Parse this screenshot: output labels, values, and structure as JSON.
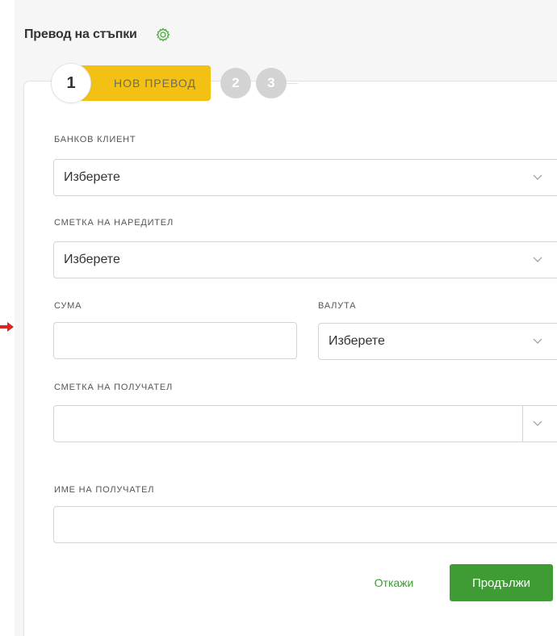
{
  "header": {
    "title": "Превод на стъпки",
    "settings_icon": "gear-icon"
  },
  "stepper": {
    "active_step_number": "1",
    "active_step_label": "НОВ ПРЕВОД",
    "step2_number": "2",
    "step3_number": "3"
  },
  "form": {
    "bank_client": {
      "label": "БАНКОВ КЛИЕНТ",
      "value": "Изберете"
    },
    "payer_account": {
      "label": "СМЕТКА НА НАРЕДИТЕЛ",
      "value": "Изберете"
    },
    "amount": {
      "label": "СУМА",
      "value": ""
    },
    "currency": {
      "label": "ВАЛУТА",
      "value": "Изберете"
    },
    "recipient_account": {
      "label": "СМЕТКА НА ПОЛУЧАТЕЛ",
      "value": ""
    },
    "recipient_name": {
      "label": "ИМЕ НА ПОЛУЧАТЕЛ",
      "value": ""
    }
  },
  "actions": {
    "cancel_label": "Откажи",
    "continue_label": "Продължи"
  },
  "colors": {
    "accent_green": "#3f9c35",
    "step_yellow": "#f2c114",
    "step_inactive_gray": "#d3d3d3",
    "pointer_arrow_red": "#d9261c"
  }
}
